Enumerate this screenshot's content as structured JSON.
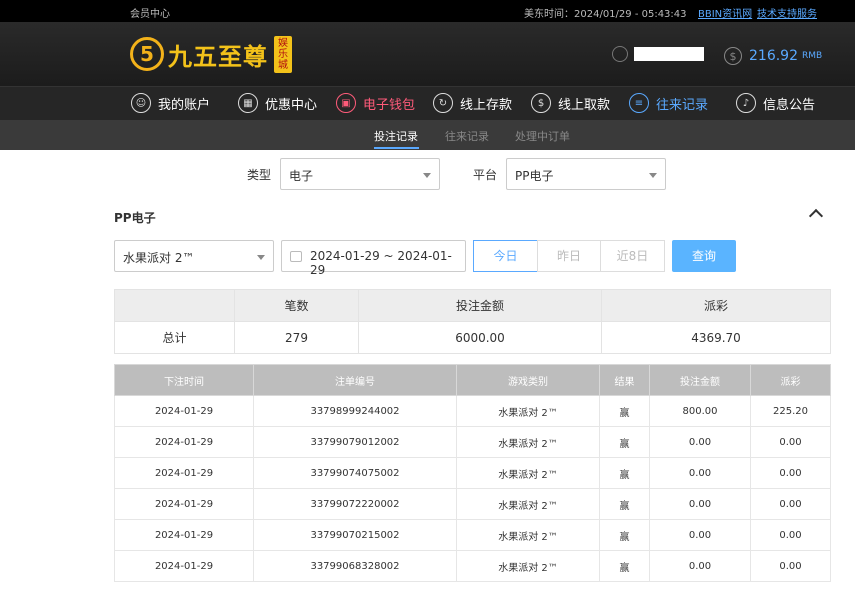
{
  "topbar": {
    "member_center": "会员中心",
    "time_label": "美东时间：2024/01/29 - 05:43:43",
    "link_news": "BBIN资讯网",
    "link_support": "技术支持服务"
  },
  "brand": {
    "logo_mark": "5",
    "logo_text": "九五至尊",
    "logo_badge": "娱乐城"
  },
  "account": {
    "balance": "216.92",
    "currency": "RMB"
  },
  "nav": {
    "items": [
      {
        "label": "我的账户",
        "icon": "user-icon"
      },
      {
        "label": "优惠中心",
        "icon": "gift-icon"
      },
      {
        "label": "电子钱包",
        "icon": "wallet-icon"
      },
      {
        "label": "线上存款",
        "icon": "deposit-icon"
      },
      {
        "label": "线上取款",
        "icon": "withdraw-icon"
      },
      {
        "label": "往来记录",
        "icon": "record-icon"
      },
      {
        "label": "信息公告",
        "icon": "bell-icon"
      }
    ]
  },
  "subnav": {
    "tabs": [
      "投注记录",
      "往来记录",
      "处理中订单"
    ]
  },
  "filters": {
    "type_label": "类型",
    "type_value": "电子",
    "platform_label": "平台",
    "platform_value": "PP电子"
  },
  "section": {
    "title": "PP电子",
    "game_value": "水果派对 2™",
    "date_range": "2024-01-29 ~ 2024-01-29",
    "btn_today": "今日",
    "btn_yesterday": "昨日",
    "btn_8days": "近8日",
    "btn_query": "查询"
  },
  "summary": {
    "headers": [
      "",
      "笔数",
      "投注金额",
      "派彩"
    ],
    "row": [
      "总计",
      "279",
      "6000.00",
      "4369.70"
    ]
  },
  "records": {
    "headers": [
      "下注时间",
      "注单编号",
      "游戏类别",
      "结果",
      "投注金额",
      "派彩"
    ],
    "rows": [
      [
        "2024-01-29",
        "33798999244002",
        "水果派对 2™",
        "赢",
        "800.00",
        "225.20"
      ],
      [
        "2024-01-29",
        "33799079012002",
        "水果派对 2™",
        "赢",
        "0.00",
        "0.00"
      ],
      [
        "2024-01-29",
        "33799074075002",
        "水果派对 2™",
        "赢",
        "0.00",
        "0.00"
      ],
      [
        "2024-01-29",
        "33799072220002",
        "水果派对 2™",
        "赢",
        "0.00",
        "0.00"
      ],
      [
        "2024-01-29",
        "33799070215002",
        "水果派对 2™",
        "赢",
        "0.00",
        "0.00"
      ],
      [
        "2024-01-29",
        "33799068328002",
        "水果派对 2™",
        "赢",
        "0.00",
        "0.00"
      ]
    ]
  }
}
